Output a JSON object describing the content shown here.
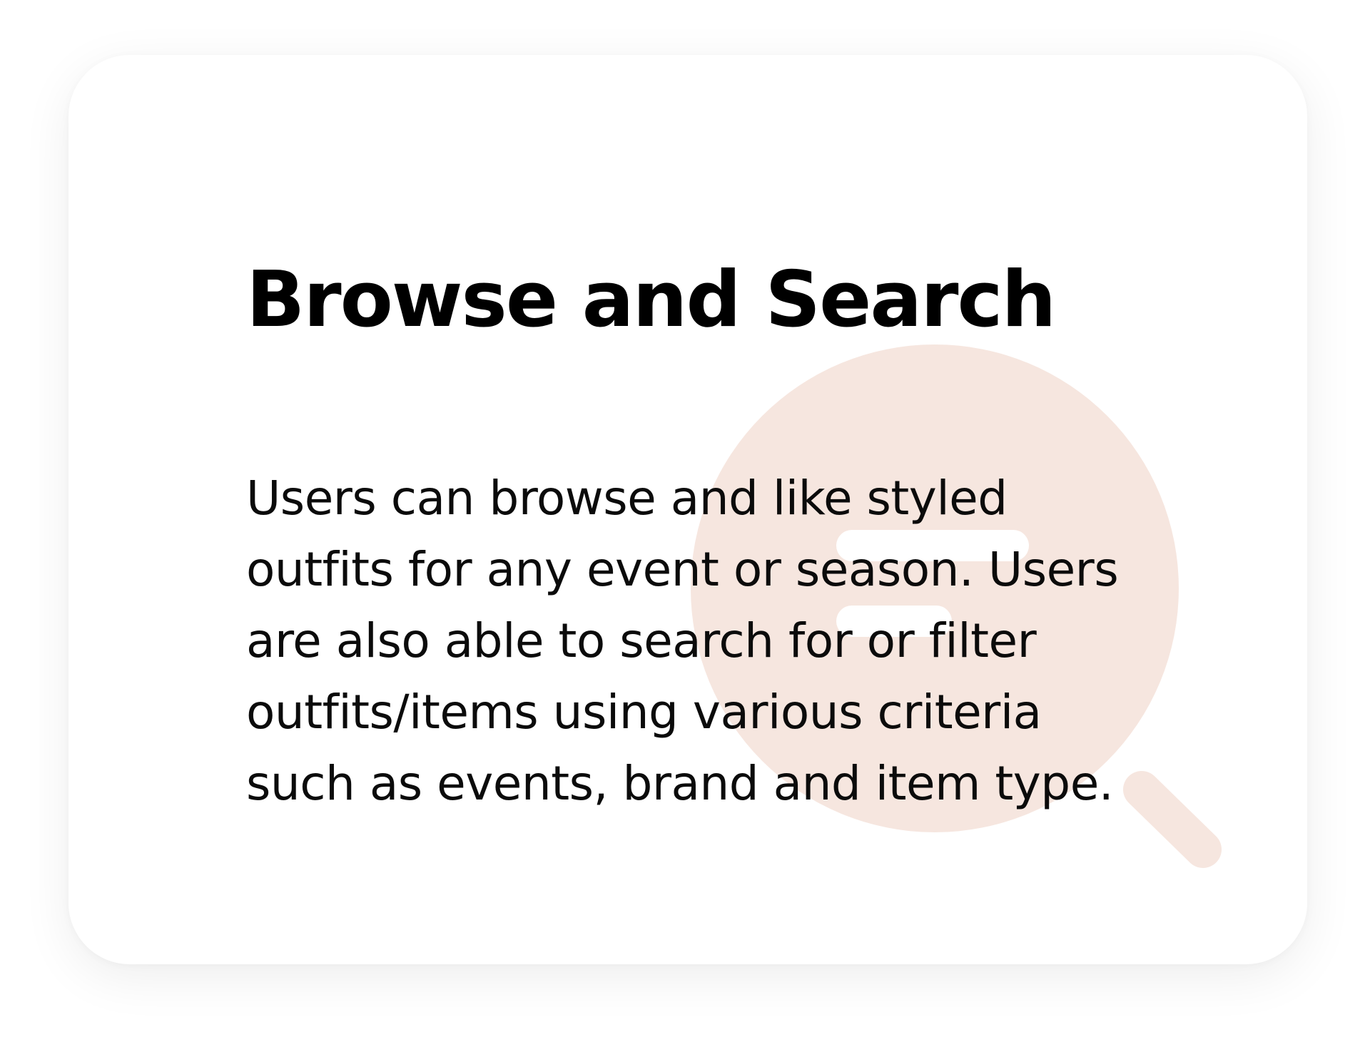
{
  "card": {
    "title": "Browse and Search",
    "body": "Users can browse and like styled outfits for any event or season. Users are also able to search for or filter outfits/items using various criteria such as events, brand and item type.",
    "illustration_icon": "magnifier-icon",
    "accent_color": "#f6e6df"
  }
}
